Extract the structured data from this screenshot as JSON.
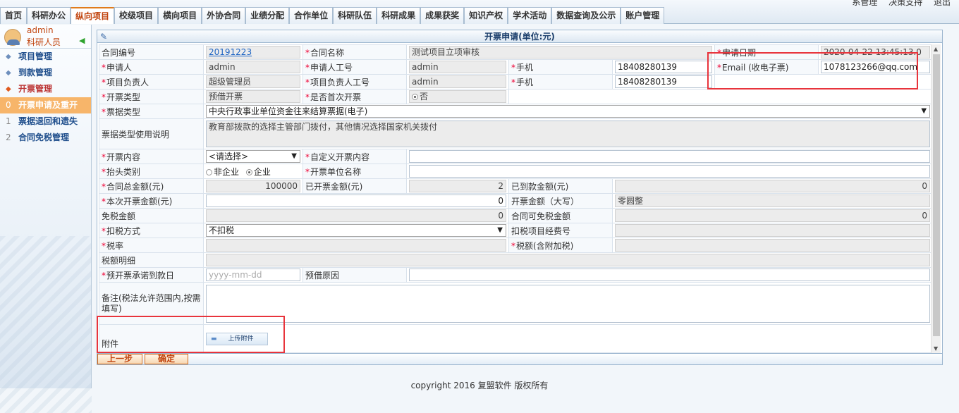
{
  "top_links": [
    "系管理",
    "决策支持",
    "退出"
  ],
  "nav": [
    {
      "label": "首页",
      "active": false
    },
    {
      "label": "科研办公",
      "active": false
    },
    {
      "label": "纵向项目",
      "active": true
    },
    {
      "label": "校级项目",
      "active": false
    },
    {
      "label": "横向项目",
      "active": false
    },
    {
      "label": "外协合同",
      "active": false
    },
    {
      "label": "业绩分配",
      "active": false
    },
    {
      "label": "合作单位",
      "active": false
    },
    {
      "label": "科研队伍",
      "active": false
    },
    {
      "label": "科研成果",
      "active": false
    },
    {
      "label": "成果获奖",
      "active": false
    },
    {
      "label": "知识产权",
      "active": false
    },
    {
      "label": "学术活动",
      "active": false
    },
    {
      "label": "数据查询及公示",
      "active": false
    },
    {
      "label": "账户管理",
      "active": false
    }
  ],
  "user": {
    "name": "admin",
    "role": "科研人员"
  },
  "sidebar": {
    "items": [
      {
        "label": "项目管理"
      },
      {
        "label": "到款管理"
      },
      {
        "label": "开票管理"
      }
    ],
    "sub_items": [
      {
        "index": "0",
        "label": "开票申请及重开"
      },
      {
        "index": "1",
        "label": "票据退回和遗失"
      },
      {
        "index": "2",
        "label": "合同免税管理"
      }
    ]
  },
  "panel_title": "开票申请(单位:元)",
  "labels": {
    "contract_no": "合同编号",
    "contract_name": "合同名称",
    "apply_date": "申请日期",
    "applicant": "申请人",
    "applicant_id": "申请人工号",
    "phone": "手机",
    "email": "Email (收电子票)",
    "leader": "项目负责人",
    "leader_id": "项目负责人工号",
    "phone2": "手机",
    "invoice_type": "开票类型",
    "first_invoice": "是否首次开票",
    "bill_type": "票据类型",
    "bill_desc": "票据类型使用说明",
    "content": "开票内容",
    "custom_content": "自定义开票内容",
    "title_type": "抬头类别",
    "unit_name": "开票单位名称",
    "total": "合同总金额(元)",
    "invoiced": "已开票金额(元)",
    "received": "已到款金额(元)",
    "this_amount": "本次开票金额(元)",
    "amount_upper": "开票金额（大写）",
    "exempt": "免税金额",
    "exempt_avail": "合同可免税金额",
    "tax_method": "扣税方式",
    "tax_item_no": "扣税项目经费号",
    "tax_rate": "税率",
    "tax_amount": "税额(含附加税)",
    "tax_detail": "税额明细",
    "promise_date": "预开票承诺到款日",
    "borrow_reason": "预借原因",
    "remark": "备注(税法允许范围内,按需填写)",
    "attachment": "附件"
  },
  "values": {
    "contract_no": "20191223",
    "contract_name": "测试项目立项审核",
    "apply_date": "2020-04-22 13:45:13.0",
    "applicant": "admin",
    "applicant_id": "admin",
    "phone": "18408280139",
    "email": "1078123266@qq.com",
    "leader": "超级管理员",
    "leader_id": "admin",
    "phone2": "18408280139",
    "invoice_type": "预借开票",
    "first_invoice_option": "否",
    "bill_type": "中央行政事业单位资金往来结算票据(电子)",
    "bill_desc": "教育部拨款的选择主管部门拨付，其他情况选择国家机关拨付",
    "content_select": "<请选择>",
    "title_options": [
      "非企业",
      "企业"
    ],
    "total": "100000",
    "invoiced": "2",
    "received": "0",
    "this_amount": "0",
    "amount_upper": "零圆整",
    "exempt": "0",
    "exempt_avail": "0",
    "tax_method": "不扣税",
    "promise_date_placeholder": "yyyy-mm-dd"
  },
  "upload_label": "上传附件",
  "buttons": {
    "prev": "上一步",
    "confirm": "确定"
  },
  "footer": "copyright 2016 复盟软件 版权所有",
  "colors": {
    "accent": "#e07b1b",
    "highlight_box": "#e8343c",
    "required": "#e00033"
  }
}
